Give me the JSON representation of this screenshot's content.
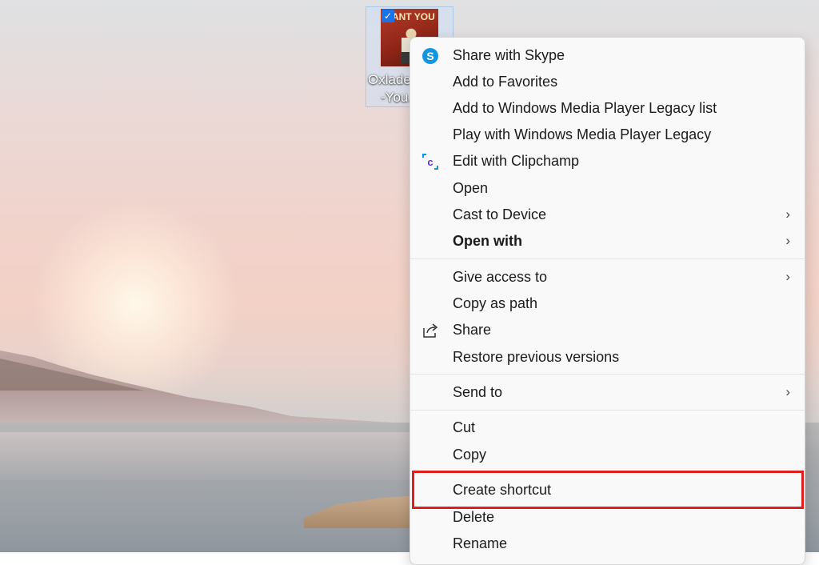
{
  "desktop_icon": {
    "label_line1": "Oxlade",
    "label_line2": "-You.",
    "thumbnail_text": "ANT YOU"
  },
  "menu": {
    "items": [
      {
        "label": "Share with Skype",
        "icon": "skype-icon"
      },
      {
        "label": "Add to Favorites"
      },
      {
        "label": "Add to Windows Media Player Legacy list"
      },
      {
        "label": "Play with Windows Media Player Legacy"
      },
      {
        "label": "Edit with Clipchamp",
        "icon": "clipchamp-icon"
      },
      {
        "label": "Open"
      },
      {
        "label": "Cast to Device",
        "submenu": true
      },
      {
        "label": "Open with",
        "submenu": true,
        "bold": true
      },
      {
        "label": "Give access to",
        "submenu": true
      },
      {
        "label": "Copy as path"
      },
      {
        "label": "Share",
        "icon": "share-icon"
      },
      {
        "label": "Restore previous versions"
      },
      {
        "label": "Send to",
        "submenu": true
      },
      {
        "label": "Cut"
      },
      {
        "label": "Copy"
      },
      {
        "label": "Create shortcut",
        "highlighted": true
      },
      {
        "label": "Delete"
      },
      {
        "label": "Rename"
      }
    ],
    "submenu_arrow": "›"
  },
  "colors": {
    "highlight_border": "#e01e1e",
    "skype_blue": "#1296e0",
    "clipchamp_purple": "#5b2ed6",
    "selection_blue": "#1a73e8"
  }
}
